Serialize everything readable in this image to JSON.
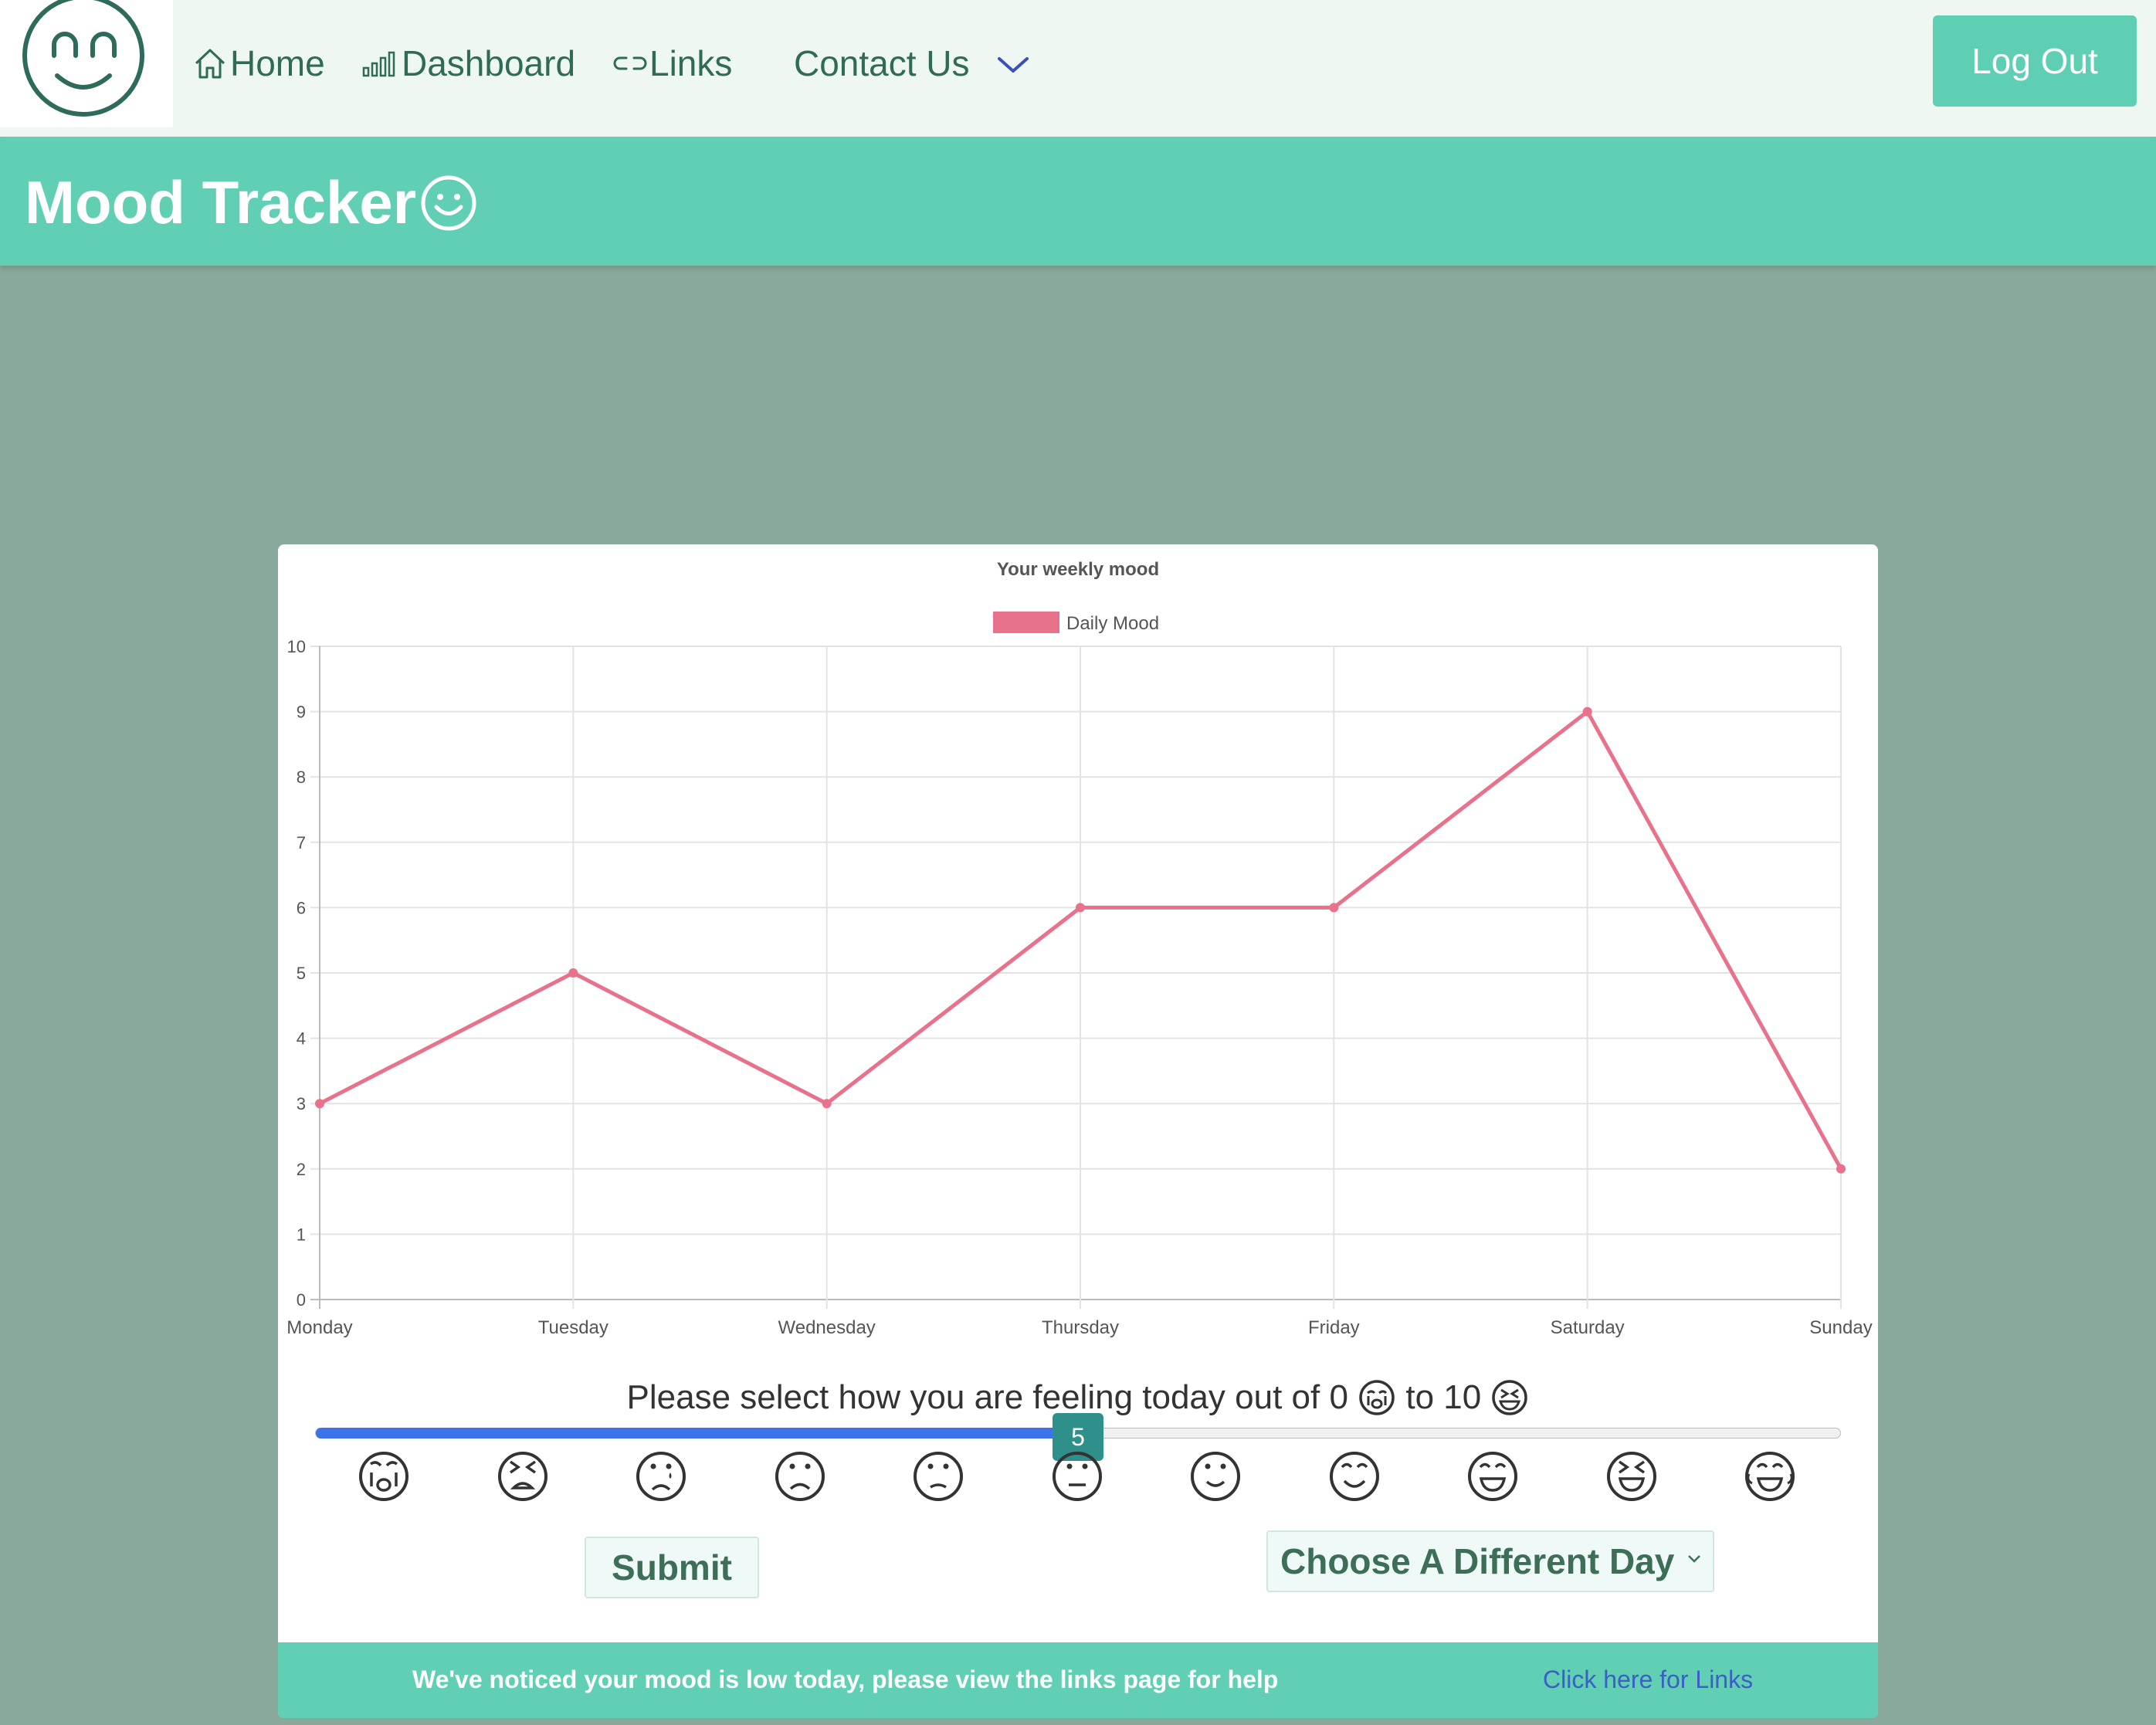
{
  "nav": {
    "items": [
      {
        "label": "Home",
        "icon": "home-icon"
      },
      {
        "label": "Dashboard",
        "icon": "bar-chart-icon"
      },
      {
        "label": "Links",
        "icon": "link-icon"
      },
      {
        "label": "Contact Us",
        "icon": "chevron-down-icon"
      }
    ],
    "logout_label": "Log Out",
    "logo_icon": "smiley-logo-icon"
  },
  "banner": {
    "title": "Mood Tracker",
    "icon": "smiley-icon"
  },
  "chart_data": {
    "type": "line",
    "title": "Your weekly mood",
    "categories": [
      "Monday",
      "Tuesday",
      "Wednesday",
      "Thursday",
      "Friday",
      "Saturday",
      "Sunday"
    ],
    "series": [
      {
        "name": "Daily Mood",
        "values": [
          3,
          5,
          3,
          6,
          6,
          9,
          2
        ],
        "color": "#e8718c"
      }
    ],
    "ylim": [
      0,
      10
    ],
    "yticks": [
      0,
      1,
      2,
      3,
      4,
      5,
      6,
      7,
      8,
      9,
      10
    ],
    "grid": true,
    "legend": "top-center"
  },
  "mood_input": {
    "prompt_prefix": "Please select how you are feeling today out of 0 ",
    "prompt_middle": " to 10 ",
    "min": 0,
    "max": 10,
    "value": 5,
    "value_label": "5",
    "faces": [
      "crying-face-icon",
      "tired-face-icon",
      "sad-tear-face-icon",
      "frown-face-icon",
      "slight-frown-face-icon",
      "neutral-face-icon",
      "smile-face-icon",
      "blush-face-icon",
      "grin-face-icon",
      "squint-grin-face-icon",
      "laugh-tears-face-icon"
    ],
    "fill_color": "#3a74e8"
  },
  "actions": {
    "submit_label": "Submit",
    "day_select_label": "Choose A Different Day"
  },
  "alert": {
    "message": "We've noticed your mood is low today, please view the links page for help",
    "link_label": "Click here for Links"
  }
}
